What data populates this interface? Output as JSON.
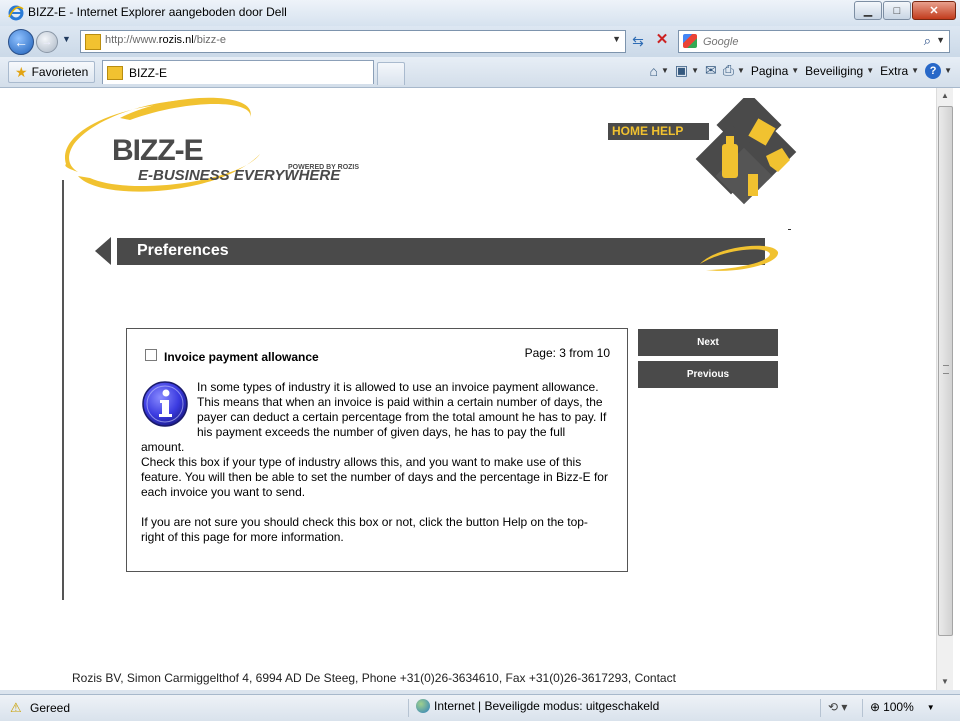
{
  "window": {
    "title": "BIZZ-E - Internet Explorer aangeboden door Dell"
  },
  "address": {
    "url_prefix": "http://www.",
    "url_domain": "rozis.nl",
    "url_path": "/bizz-e"
  },
  "search": {
    "placeholder": "Google"
  },
  "tabs": {
    "favorites_label": "Favorieten",
    "active_tab": "BIZZ-E"
  },
  "commandbar": {
    "page": "Pagina",
    "security": "Beveiliging",
    "extra": "Extra"
  },
  "page": {
    "logo_main": "BIZZ-E",
    "logo_sub": "E-BUSINESS EVERYWHERE",
    "logo_powered": "POWERED BY ROZIS",
    "home_help": "HOME HELP",
    "section_title": "Preferences",
    "checkbox_label": "Invoice payment allowance",
    "page_info": "Page: 3 from 10",
    "description": "In some types of industry it is allowed to use an invoice payment allowance. This means that when an invoice is paid within a certain number of days, the payer can deduct a certain percentage from the total amount he has to pay. If his payment exceeds the number of given days, he has to pay the full amount.",
    "instruction": "Check this box if your type of industry allows this, and you want to make use of this feature. You will then be able to set the number of days and the percentage in Bizz-E for each invoice you want to send.",
    "help_note": "If you are not sure you should check this box or not, click the button Help on the top-right of this page for more information.",
    "next_label": "Next",
    "previous_label": "Previous",
    "footer": "Rozis BV, Simon Carmiggelthof 4, 6994 AD De Steeg, Phone +31(0)26-3634610, Fax +31(0)26-3617293, Contact"
  },
  "status": {
    "ready": "Gereed",
    "zone": "Internet | Beveiligde modus: uitgeschakeld",
    "zoom": "100%"
  },
  "colors": {
    "brand_yellow": "#f1c230",
    "dark_gray": "#4a4a4a"
  }
}
